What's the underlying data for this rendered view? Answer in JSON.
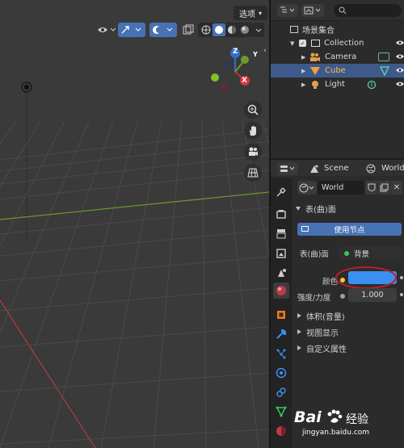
{
  "viewport": {
    "options_label": "选项",
    "axis_labels": {
      "z": "Z",
      "y": "Y",
      "x": "X"
    },
    "colors": {
      "bg": "#3a3a3a",
      "x_axis": "#b8383a",
      "y_axis": "#6c9a2e",
      "z_axis": "#2f6fc9"
    },
    "icons": [
      "view-object-types-icon",
      "transform-gizmo-icon",
      "overlays-icon",
      "xray-icon",
      "wireframe-shading-icon",
      "solid-shading-icon",
      "material-shading-icon",
      "rendered-shading-icon",
      "zoom-icon",
      "pan-hand-icon",
      "camera-view-icon",
      "grid-ortho-icon"
    ]
  },
  "outliner": {
    "search_placeholder": "",
    "scene_collection": "场景集合",
    "items": [
      {
        "label": "Collection",
        "type": "collection"
      },
      {
        "label": "Camera",
        "type": "camera"
      },
      {
        "label": "Cube",
        "type": "mesh",
        "selected": true
      },
      {
        "label": "Light",
        "type": "light"
      }
    ]
  },
  "properties": {
    "scene_label": "Scene",
    "world_label": "World",
    "world_name": "World",
    "surface_panel": "表(曲)面",
    "use_nodes_button": "使用节点",
    "surface_label": "表(曲)面",
    "surface_value": "背景",
    "color_label": "颜色",
    "color_value": "#3a8ff0",
    "strength_label": "强度/力度",
    "strength_value": "1.000",
    "subpanels": [
      "体积(音量)",
      "视图显示",
      "自定义属性"
    ]
  },
  "watermark": {
    "brand": "Bai",
    "brand_suffix": "经验",
    "url": "jingyan.baidu.com"
  }
}
